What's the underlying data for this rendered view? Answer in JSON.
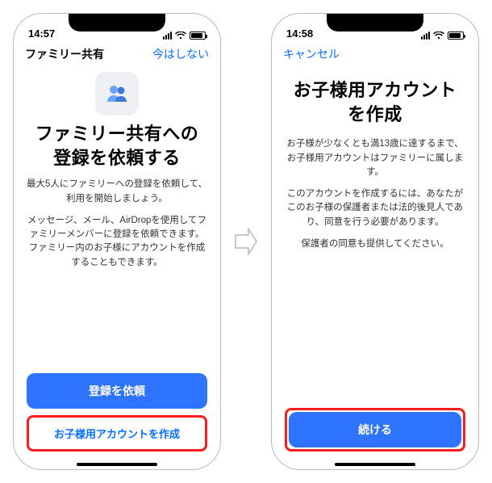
{
  "screen1": {
    "time": "14:57",
    "navTitle": "ファミリー共有",
    "navAction": "今はしない",
    "title": "ファミリー共有への登録を依頼する",
    "p1": "最大5人にファミリーへの登録を依頼して、利用を開始しましょう。",
    "p2": "メッセージ、メール、AirDropを使用してファミリーメンバーに登録を依頼できます。ファミリー内のお子様にアカウントを作成することもできます。",
    "cta": "登録を依頼",
    "link": "お子様用アカウントを作成"
  },
  "screen2": {
    "time": "14:58",
    "cancel": "キャンセル",
    "title": "お子様用アカウントを作成",
    "p1": "お子様が少なくとも満13歳に達するまで、お子様用アカウントはファミリーに属します。",
    "p2": "このアカウントを作成するには、あなたがこのお子様の保護者または法的後見人であり、同意を行う必要があります。",
    "p3": "保護者の同意も提供してください。",
    "cta": "続ける"
  }
}
